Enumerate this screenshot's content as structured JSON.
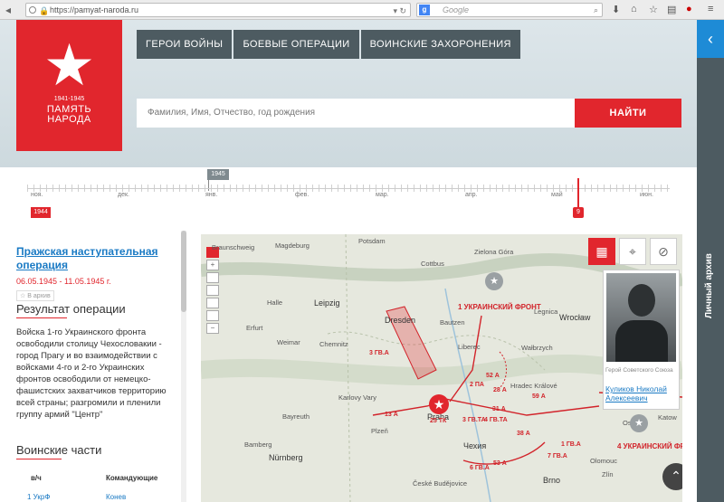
{
  "browser": {
    "url": "https://pamyat-naroda.ru",
    "search_engine": "Google",
    "search_placeholder": "Google"
  },
  "logo": {
    "years": "1941-1945",
    "name_line1": "ПАМЯТЬ",
    "name_line2": "НАРОДА"
  },
  "nav": {
    "items": [
      "ГЕРОИ ВОЙНЫ",
      "БОЕВЫЕ ОПЕРАЦИИ",
      "ВОИНСКИЕ ЗАХОРОНЕНИЯ"
    ]
  },
  "search": {
    "placeholder": "Фамилия, Имя, Отчество, год рождения",
    "button": "НАЙТИ"
  },
  "side_tab": {
    "label": "Личный архив",
    "arrow": "‹"
  },
  "timeline": {
    "year_label": "1945",
    "start_label": "1944",
    "selected_day": "9",
    "months": [
      "ноя.",
      "дек.",
      "янв.",
      "фев.",
      "мар.",
      "апр.",
      "май",
      "июн."
    ]
  },
  "operation": {
    "title": "Пражская наступательная операция",
    "dates": "06.05.1945 - 11.05.1945 г.",
    "favorite": "☆ В архив",
    "result_heading": "Результат операции",
    "result_text": "Войска 1-го Украинского фронта освободили столицу Чехословакии - город Прагу и во взаимодействии с войсками 4-го и 2-го Украинских фронтов освободили от немецко-фашистских захватчиков территорию всей страны; разгромили и пленили группу армий \"Центр\"",
    "units_heading": "Воинские части",
    "units_columns": [
      "в/ч",
      "Командующие"
    ],
    "units_rows": [
      {
        "unit": "1 УкрФ",
        "commander": "Конев"
      }
    ]
  },
  "map": {
    "tools": [
      "map-icon",
      "pin-icon",
      "no-pin-icon"
    ],
    "labels": [
      {
        "name": "Potsdam",
        "cls": ""
      },
      {
        "name": "Braunschweig",
        "cls": ""
      },
      {
        "name": "Magdeburg",
        "cls": ""
      },
      {
        "name": "Zielona Góra",
        "cls": ""
      },
      {
        "name": "Cottbus",
        "cls": ""
      },
      {
        "name": "Halle",
        "cls": ""
      },
      {
        "name": "Leipzig",
        "cls": "big"
      },
      {
        "name": "Dresden",
        "cls": "big"
      },
      {
        "name": "Bautzen",
        "cls": ""
      },
      {
        "name": "Legnica",
        "cls": ""
      },
      {
        "name": "Wrocław",
        "cls": "big"
      },
      {
        "name": "Erfurt",
        "cls": ""
      },
      {
        "name": "Weimar",
        "cls": ""
      },
      {
        "name": "Chemnitz",
        "cls": ""
      },
      {
        "name": "Liberec",
        "cls": ""
      },
      {
        "name": "Wałbrzych",
        "cls": ""
      },
      {
        "name": "Hradec Králové",
        "cls": ""
      },
      {
        "name": "Karlovy Vary",
        "cls": ""
      },
      {
        "name": "Bayreuth",
        "cls": ""
      },
      {
        "name": "Plzeň",
        "cls": ""
      },
      {
        "name": "Bamberg",
        "cls": ""
      },
      {
        "name": "Nürnberg",
        "cls": "big"
      },
      {
        "name": "Brno",
        "cls": "big"
      },
      {
        "name": "Olomouc",
        "cls": ""
      },
      {
        "name": "Ostrava",
        "cls": ""
      },
      {
        "name": "Katow",
        "cls": ""
      },
      {
        "name": "České Budějovice",
        "cls": ""
      },
      {
        "name": "Zlín",
        "cls": ""
      },
      {
        "name": "Praha",
        "cls": "big"
      },
      {
        "name": "Чехия",
        "cls": "big"
      }
    ],
    "fronts": [
      "1 УКРАИНСКИЙ ФРОНТ",
      "4 УКРАИНСКИЙ ФРОНТ"
    ],
    "armies": [
      "3 ГВ.А",
      "13 А",
      "52 А",
      "2 ПА",
      "59 А",
      "28 А",
      "31 А",
      "38 А",
      "1 ГВ.А",
      "7 ГВ.А",
      "6 ГВ.А",
      "53 А",
      "4 ГВ.ТА",
      "3 ГВ.ТА",
      "25 ТК"
    ],
    "hero": {
      "title": "Герой Советского Союза",
      "name": "Куликов Николай Алексеевич"
    }
  }
}
